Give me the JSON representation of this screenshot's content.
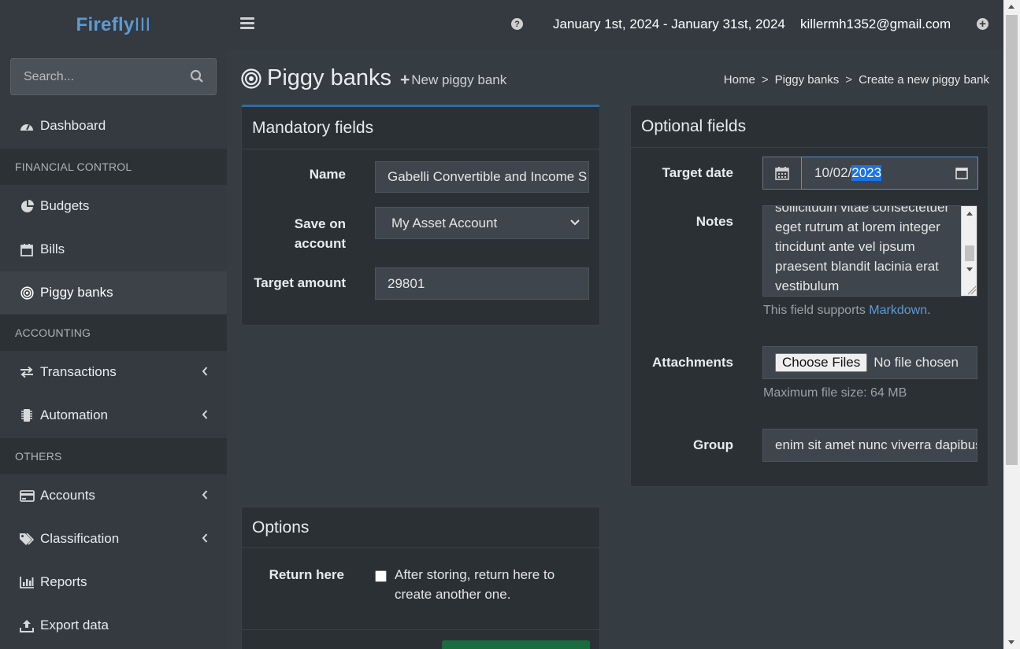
{
  "app": {
    "logo_bold": "Firefly",
    "logo_thin": "III"
  },
  "topbar": {
    "date_range": "January 1st, 2024 - January 31st, 2024",
    "user_email": "killermh1352@gmail.com"
  },
  "sidebar": {
    "search_placeholder": "Search...",
    "dashboard": "Dashboard",
    "header_financial": "FINANCIAL CONTROL",
    "budgets": "Budgets",
    "bills": "Bills",
    "piggy_banks": "Piggy banks",
    "header_accounting": "ACCOUNTING",
    "transactions": "Transactions",
    "automation": "Automation",
    "header_others": "OTHERS",
    "accounts": "Accounts",
    "classification": "Classification",
    "reports": "Reports",
    "export_data": "Export data"
  },
  "page": {
    "title": "Piggy banks",
    "new_link": "New piggy bank",
    "breadcrumb": [
      "Home",
      "Piggy banks",
      "Create a new piggy bank"
    ]
  },
  "mandatory": {
    "header": "Mandatory fields",
    "name_label": "Name",
    "name_value": "Gabelli Convertible and Income S",
    "account_label_1": "Save on",
    "account_label_2": "account",
    "account_value": "My Asset Account",
    "amount_label": "Target amount",
    "amount_value": "29801"
  },
  "optional": {
    "header": "Optional fields",
    "date_label": "Target date",
    "date_prefix": "10/02/",
    "date_selected": "2023",
    "notes_label": "Notes",
    "notes_text": "sollicitudin vitae consectetuer\neget rutrum at lorem integer\ntincidunt ante vel ipsum\npraesent blandit lacinia erat\nvestibulum",
    "notes_help_prefix": "This field supports ",
    "notes_help_link": "Markdown",
    "notes_help_suffix": ".",
    "attachments_label": "Attachments",
    "choose_files": "Choose Files",
    "no_file": "No file chosen",
    "max_size": "Maximum file size: 64 MB",
    "group_label": "Group",
    "group_value": "enim sit amet nunc viverra dapibus"
  },
  "options": {
    "header": "Options",
    "return_label": "Return here",
    "return_text": "After storing, return here to create another one."
  },
  "colors": {
    "accent": "#5b9bd5",
    "submit": "#1a6b3e",
    "sidebar": "#343a40"
  }
}
